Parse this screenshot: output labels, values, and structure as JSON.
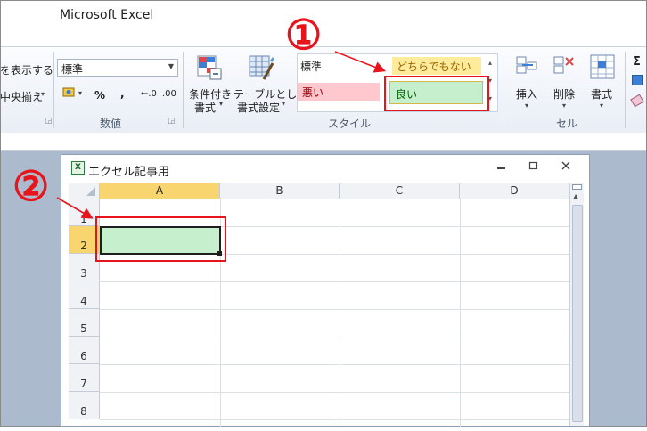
{
  "app": {
    "title": "Microsoft Excel"
  },
  "ribbon": {
    "wrap_text_label": "を表示する",
    "merge_center_label": "中央揃え",
    "number_format_value": "標準",
    "currency_label": "%",
    "comma_label": ",",
    "inc_decimal_label": "←.0",
    "dec_decimal_label": ".00",
    "number_group_label": "数値",
    "conditional_format_label_1": "条件付き",
    "conditional_format_label_2": "書式",
    "table_format_label_1": "テーブルとして",
    "table_format_label_2": "書式設定",
    "styles": {
      "normal": "標準",
      "neutral": "どちらでもない",
      "bad": "悪い",
      "good": "良い"
    },
    "styles_group_label": "スタイル",
    "insert_label": "挿入",
    "delete_label": "削除",
    "format_label": "書式",
    "cells_group_label": "セル",
    "sigma_label": "Σ"
  },
  "callouts": {
    "one": "①",
    "two": "②"
  },
  "workbook": {
    "title": "エクセル記事用",
    "icon_letter": "X",
    "columns": [
      "A",
      "B",
      "C",
      "D"
    ],
    "rows": [
      "1",
      "2",
      "3",
      "4",
      "5",
      "6",
      "7",
      "8"
    ],
    "minimize": "▭",
    "restore": "◻",
    "close": "✕"
  },
  "colors": {
    "good_fill": "#c6efce",
    "good_text": "#006100",
    "bad_fill": "#ffc7ce",
    "bad_text": "#9c0006",
    "neutral_fill": "#ffeb9c",
    "neutral_text": "#9c6500",
    "highlight_red": "#e8141c",
    "selected_header": "#f8d56f"
  }
}
